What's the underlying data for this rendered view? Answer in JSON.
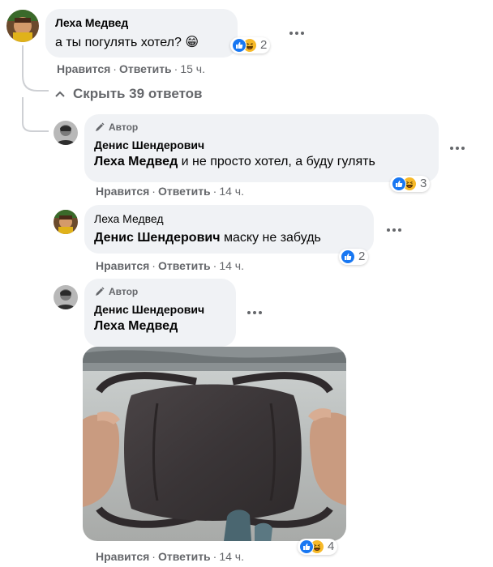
{
  "comments": {
    "top": {
      "author": "Леха Медвед",
      "text": "а ты погулять хотел?",
      "emoji": "😁",
      "reactions_count": "2",
      "like_label": "Нравится",
      "reply_label": "Ответить",
      "time": "15 ч."
    },
    "hide_replies": "Скрыть 39 ответов",
    "reply1": {
      "author_tag": "Автор",
      "author": "Денис Шендерович",
      "mention": "Леха Медвед",
      "text": " и не просто хотел, а буду гулять",
      "reactions_count": "3",
      "like_label": "Нравится",
      "reply_label": "Ответить",
      "time": "14 ч."
    },
    "reply2": {
      "author": "Леха Медвед",
      "mention": "Денис Шендерович",
      "text": " маску не забудь",
      "reactions_count": "2",
      "like_label": "Нравится",
      "reply_label": "Ответить",
      "time": "14 ч."
    },
    "reply3": {
      "author_tag": "Автор",
      "author": "Денис Шендерович",
      "mention": "Леха Медвед",
      "reactions_count": "4",
      "like_label": "Нравится",
      "reply_label": "Ответить",
      "time": "14 ч."
    }
  },
  "colors": {
    "bubble": "#f0f2f5",
    "secondary_text": "#65676b",
    "like_blue": "#1877f2",
    "haha_yellow": "#f7b928"
  },
  "icons": [
    "like-reaction-icon",
    "haha-reaction-icon",
    "pen-author-icon",
    "chevron-up-icon",
    "more-dots-icon"
  ]
}
